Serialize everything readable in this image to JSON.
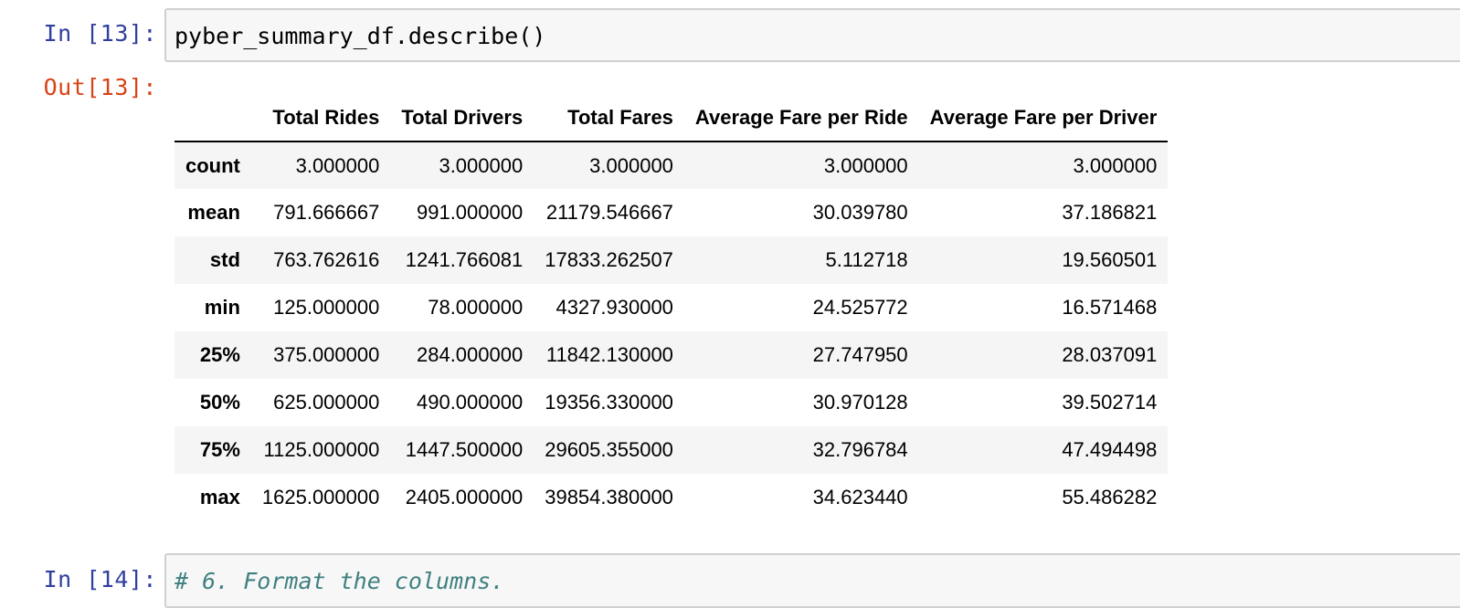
{
  "cell13": {
    "in_prompt": "In [13]:",
    "code": "pyber_summary_df.describe()",
    "out_prompt": "Out[13]:"
  },
  "table": {
    "columns": [
      "",
      "Total Rides",
      "Total Drivers",
      "Total Fares",
      "Average Fare per Ride",
      "Average Fare per Driver"
    ],
    "rows": [
      {
        "label": "count",
        "values": [
          "3.000000",
          "3.000000",
          "3.000000",
          "3.000000",
          "3.000000"
        ]
      },
      {
        "label": "mean",
        "values": [
          "791.666667",
          "991.000000",
          "21179.546667",
          "30.039780",
          "37.186821"
        ]
      },
      {
        "label": "std",
        "values": [
          "763.762616",
          "1241.766081",
          "17833.262507",
          "5.112718",
          "19.560501"
        ]
      },
      {
        "label": "min",
        "values": [
          "125.000000",
          "78.000000",
          "4327.930000",
          "24.525772",
          "16.571468"
        ]
      },
      {
        "label": "25%",
        "values": [
          "375.000000",
          "284.000000",
          "11842.130000",
          "27.747950",
          "28.037091"
        ]
      },
      {
        "label": "50%",
        "values": [
          "625.000000",
          "490.000000",
          "19356.330000",
          "30.970128",
          "39.502714"
        ]
      },
      {
        "label": "75%",
        "values": [
          "1125.000000",
          "1447.500000",
          "29605.355000",
          "32.796784",
          "47.494498"
        ]
      },
      {
        "label": "max",
        "values": [
          "1625.000000",
          "2405.000000",
          "39854.380000",
          "34.623440",
          "55.486282"
        ]
      }
    ]
  },
  "cell14": {
    "in_prompt": "In [14]:",
    "code": "# 6. Format the columns."
  }
}
